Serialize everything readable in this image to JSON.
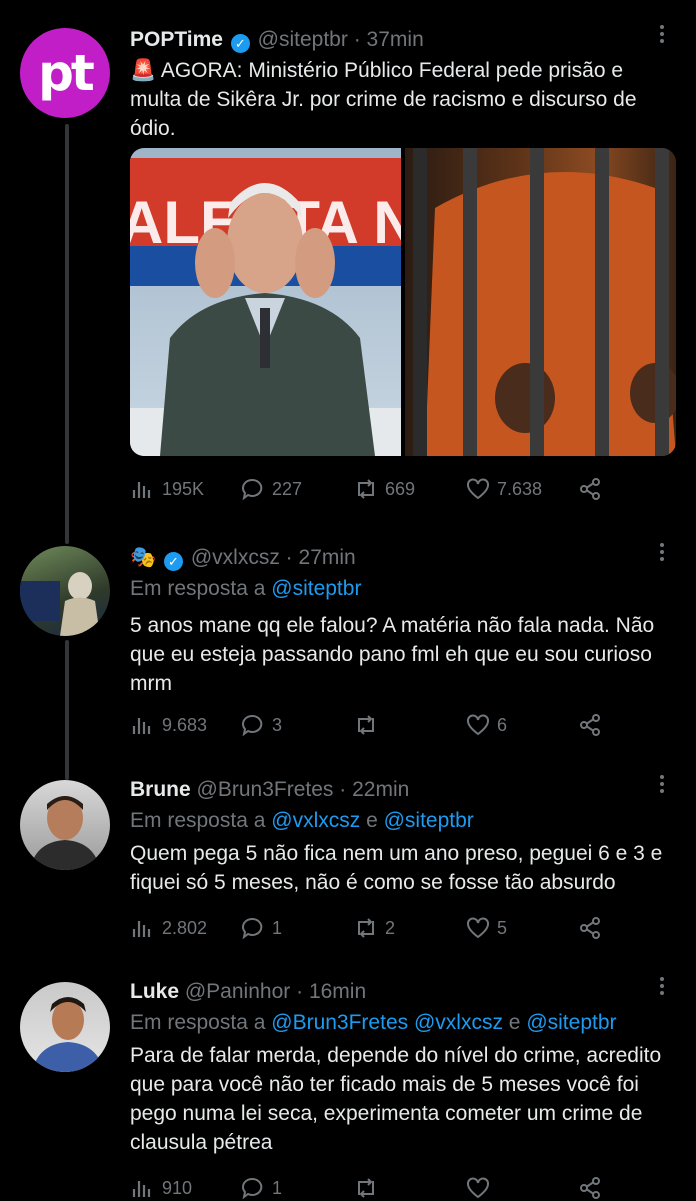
{
  "tweets": [
    {
      "name": "POPTime",
      "verified": true,
      "handle": "@siteptbr",
      "time": "37min",
      "avatar_text": "pt",
      "text": "🚨 AGORA: Ministério Público Federal pede prisão e multa de Sikêra Jr. por crime de racismo e discurso de ódio.",
      "stats": {
        "views": "195K",
        "replies": "227",
        "retweets": "669",
        "likes": "7.638"
      }
    },
    {
      "name": "🎭",
      "verified": true,
      "handle": "@vxlxcsz",
      "time": "27min",
      "reply_prefix": "Em resposta a",
      "reply_to": "@siteptbr",
      "text": "5 anos mane qq ele falou? A matéria não fala nada. Não que eu esteja passando pano fml eh que eu sou curioso mrm",
      "stats": {
        "views": "9.683",
        "replies": "3",
        "retweets": "",
        "likes": "6"
      }
    },
    {
      "name": "Brune",
      "handle": "@Brun3Fretes",
      "time": "22min",
      "reply_prefix": "Em resposta a",
      "reply_to_1": "@vxlxcsz",
      "reply_and": "e",
      "reply_to_2": "@siteptbr",
      "text": "Quem pega 5 não fica nem um ano preso, peguei 6 e 3 e fiquei só 5 meses, não é como se fosse tão absurdo",
      "stats": {
        "views": "2.802",
        "replies": "1",
        "retweets": "2",
        "likes": "5"
      }
    },
    {
      "name": "Luke",
      "handle": "@Paninhor",
      "time": "16min",
      "reply_prefix": "Em resposta a",
      "reply_to_1": "@Brun3Fretes",
      "reply_to_2": "@vxlxcsz",
      "reply_and": "e",
      "reply_to_3": "@siteptbr",
      "text": "Para de falar merda, depende do nível do crime, acredito que para você não ter ficado mais de 5 meses você foi pego numa lei seca, experimenta cometer um crime de clausula pétrea",
      "stats": {
        "views": "910",
        "replies": "1",
        "retweets": "",
        "likes": ""
      }
    }
  ],
  "media_image_text": "ALERTA NACIONAL",
  "colors": {
    "background": "#000000",
    "text": "#e7e9ea",
    "muted": "#71767b",
    "accent": "#1d9bf0",
    "brand": "#c21ec8"
  }
}
